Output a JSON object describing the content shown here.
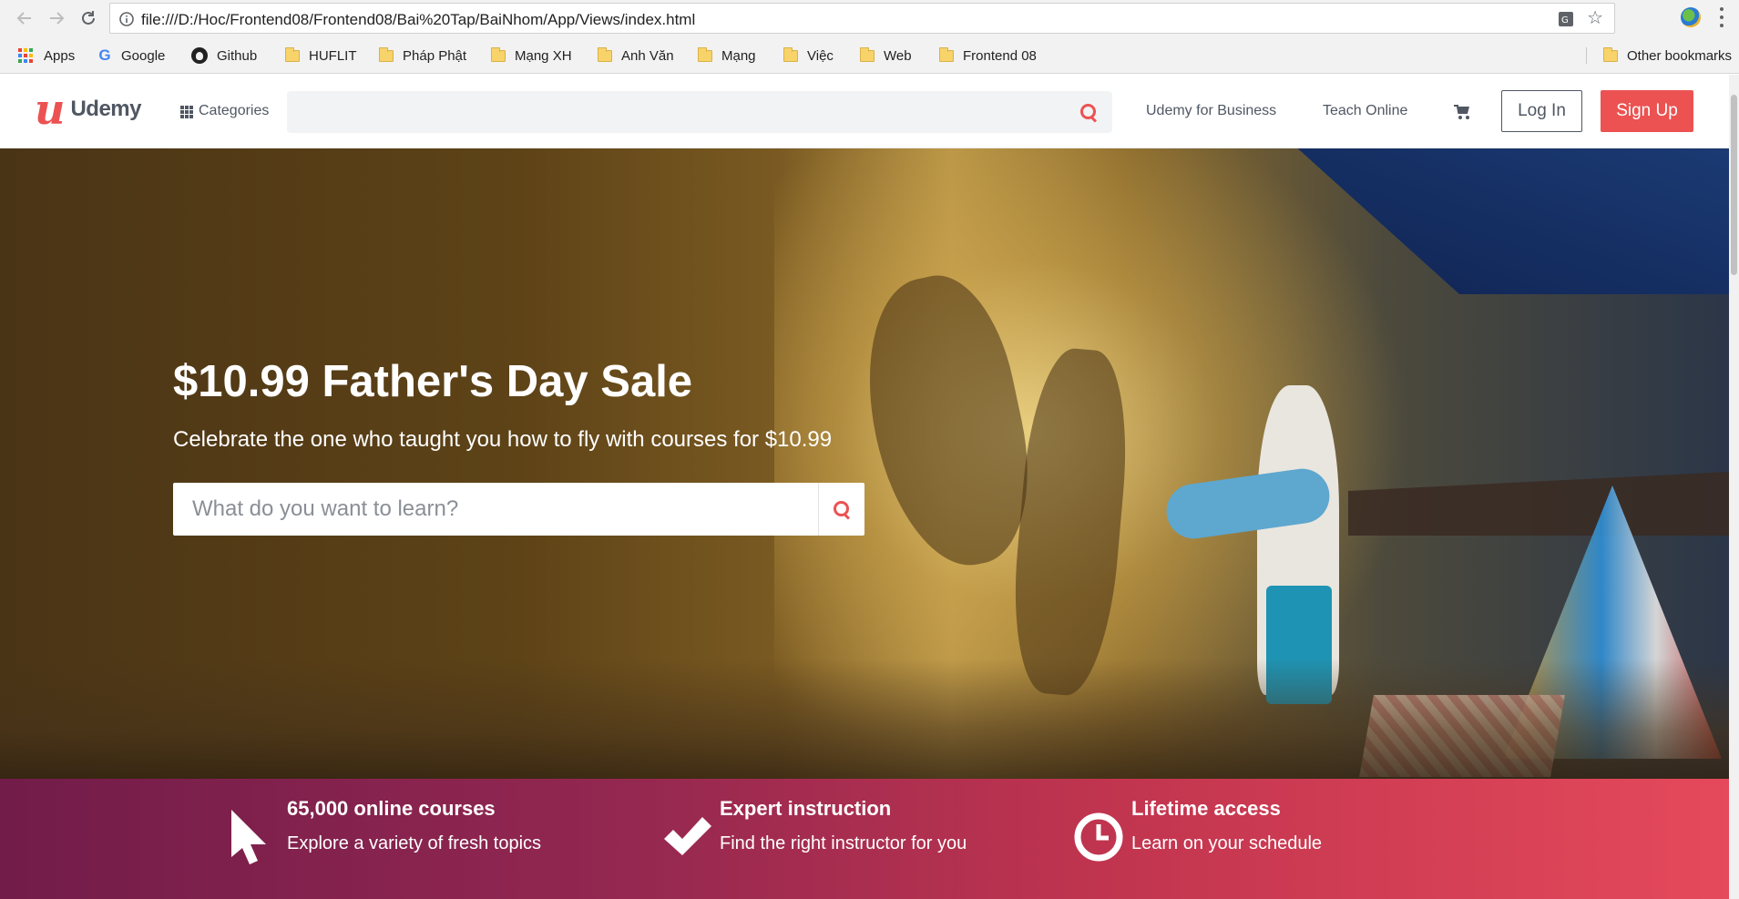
{
  "browser": {
    "url": "file:///D:/Hoc/Frontend08/Frontend08/Bai%20Tap/BaiNhom/App/Views/index.html",
    "bookmarks": [
      {
        "label": "Apps",
        "icon": "apps-grid-icon"
      },
      {
        "label": "Google",
        "icon": "google-icon"
      },
      {
        "label": "Github",
        "icon": "github-icon"
      },
      {
        "label": "HUFLIT",
        "icon": "folder-icon"
      },
      {
        "label": "Pháp Phật",
        "icon": "folder-icon"
      },
      {
        "label": "Mạng XH",
        "icon": "folder-icon"
      },
      {
        "label": "Anh Văn",
        "icon": "folder-icon"
      },
      {
        "label": "Mạng",
        "icon": "folder-icon"
      },
      {
        "label": "Việc",
        "icon": "folder-icon"
      },
      {
        "label": "Web",
        "icon": "folder-icon"
      },
      {
        "label": "Frontend 08",
        "icon": "folder-icon"
      }
    ],
    "other_bookmarks": "Other bookmarks"
  },
  "header": {
    "logo_text": "Udemy",
    "categories_label": "Categories",
    "search_placeholder": "",
    "nav": {
      "business": "Udemy for Business",
      "teach": "Teach Online"
    },
    "login_label": "Log In",
    "signup_label": "Sign Up"
  },
  "hero": {
    "title": "$10.99 Father's Day Sale",
    "subtitle": "Celebrate the one who taught you how to fly with courses for $10.99",
    "search_placeholder": "What do you want to learn?"
  },
  "features": [
    {
      "icon": "cursor-icon",
      "title": "65,000 online courses",
      "text": "Explore a variety of fresh topics"
    },
    {
      "icon": "checkmark-icon",
      "title": "Expert instruction",
      "text": "Find the right instructor for you"
    },
    {
      "icon": "clock-icon",
      "title": "Lifetime access",
      "text": "Learn on your schedule"
    }
  ],
  "colors": {
    "brand": "#ec5252",
    "text": "#505763",
    "band_start": "#721c4a",
    "band_end": "#e5495b"
  }
}
